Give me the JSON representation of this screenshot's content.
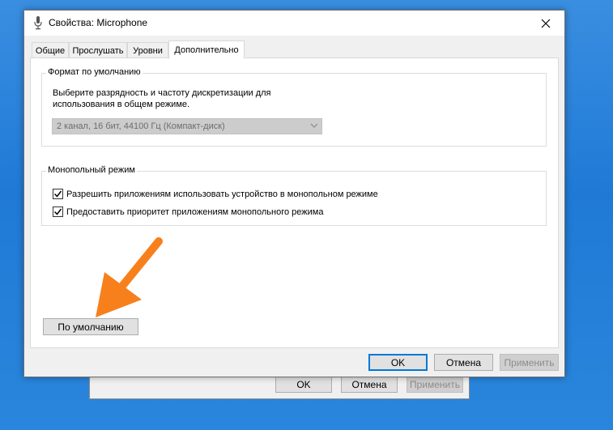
{
  "window": {
    "title": "Свойства: Microphone",
    "title_icon": "microphone-icon",
    "close_icon": "close-icon"
  },
  "tabs": [
    {
      "label": "Общие"
    },
    {
      "label": "Прослушать"
    },
    {
      "label": "Уровни"
    },
    {
      "label": "Дополнительно",
      "active": true
    }
  ],
  "default_format": {
    "legend": "Формат по умолчанию",
    "description_line1": "Выберите разрядность и частоту дискретизации для",
    "description_line2": "использования в общем режиме.",
    "selected_value": "2 канал, 16 бит, 44100 Гц (Компакт-диск)"
  },
  "exclusive_mode": {
    "legend": "Монопольный режим",
    "options": [
      {
        "label": "Разрешить приложениям использовать устройство в монопольном режиме",
        "checked": true
      },
      {
        "label": "Предоставить приоритет приложениям монопольного режима",
        "checked": true
      }
    ]
  },
  "restore_defaults_label": "По умолчанию",
  "footer": {
    "ok_label": "OK",
    "cancel_label": "Отмена",
    "apply_label": "Применить"
  },
  "background_dialog": {
    "ok_label": "OK",
    "cancel_label": "Отмена",
    "apply_label": "Применить"
  },
  "colors": {
    "accent": "#0078d7",
    "annotation_arrow": "#f7801d"
  }
}
